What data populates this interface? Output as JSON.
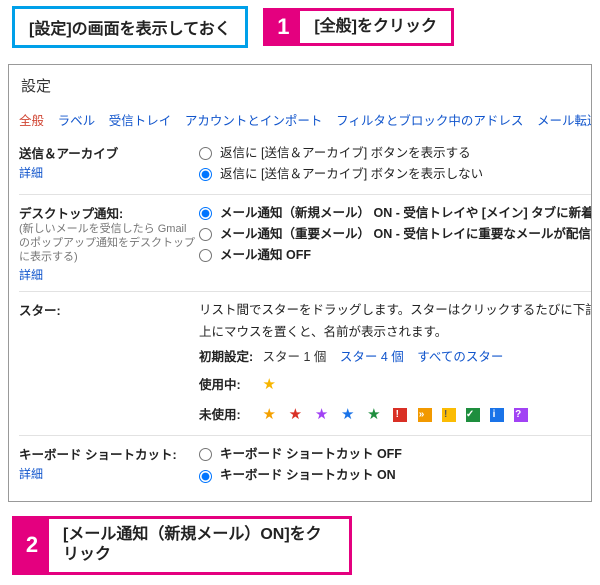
{
  "callout_header": "[設定]の画面を表示しておく",
  "steps": [
    {
      "num": "1",
      "text": "[全般]をクリック"
    },
    {
      "num": "2",
      "text": "[メール通知（新規メール）ON]をクリック"
    }
  ],
  "page_title": "設定",
  "tabs": [
    "全般",
    "ラベル",
    "受信トレイ",
    "アカウントとインポート",
    "フィルタとブロック中のアドレス",
    "メール転送と PO"
  ],
  "send_archive": {
    "label": "送信＆アーカイブ",
    "detail": "詳細",
    "opt1": "返信に [送信＆アーカイブ] ボタンを表示する",
    "opt2": "返信に [送信＆アーカイブ] ボタンを表示しない"
  },
  "desktop_notify": {
    "label": "デスクトップ通知:",
    "sub": "(新しいメールを受信したら Gmail のポップアップ通知をデスクトップに表示する)",
    "detail": "詳細",
    "opt1": "メール通知（新規メール） ON - 受信トレイや [メイン] タブに新着メー",
    "opt2": "メール通知（重要メール） ON - 受信トレイに重要なメールが配信され",
    "opt3": "メール通知 OFF"
  },
  "stars": {
    "label": "スター:",
    "desc1": "リスト間でスターをドラッグします。スターはクリックするたびに下記の",
    "desc2": "上にマウスを置くと、名前が表示されます。",
    "preset_label": "初期設定:",
    "preset_opts": [
      "スター 1 個",
      "スター 4 個",
      "すべてのスター"
    ],
    "using_label": "使用中:",
    "unused_label": "未使用:"
  },
  "shortcuts": {
    "label": "キーボード ショートカット:",
    "detail": "詳細",
    "opt_off": "キーボード ショートカット OFF",
    "opt_on": "キーボード ショートカット ON"
  }
}
